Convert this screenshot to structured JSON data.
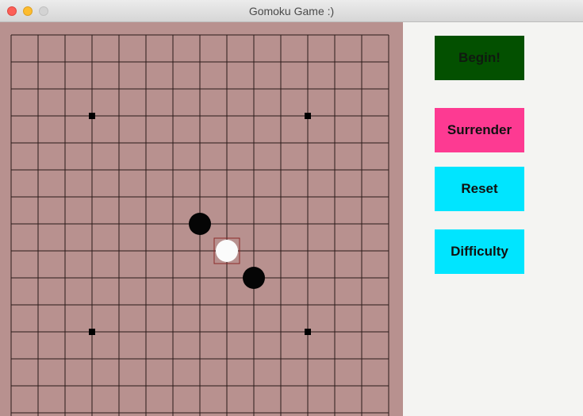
{
  "window": {
    "title": "Gomoku Game :)"
  },
  "board": {
    "background_color": "#b8918f",
    "line_color": "#2a1a1a",
    "stones": [
      {
        "color": "black",
        "col": 7,
        "row": 7
      },
      {
        "color": "white",
        "col": 8,
        "row": 8
      },
      {
        "color": "black",
        "col": 9,
        "row": 9
      }
    ],
    "star_points": [
      {
        "col": 3,
        "row": 3
      },
      {
        "col": 11,
        "row": 3
      },
      {
        "col": 3,
        "row": 11
      },
      {
        "col": 11,
        "row": 11
      }
    ],
    "last_move": {
      "col": 8,
      "row": 8
    }
  },
  "sidebar": {
    "begin_label": "Begin!",
    "surrender_label": "Surrender",
    "reset_label": "Reset",
    "difficulty_label": "Difficulty",
    "colors": {
      "begin": "#035000",
      "surrender": "#fd3a92",
      "reset": "#00e5ff",
      "difficulty": "#00e5ff"
    }
  }
}
